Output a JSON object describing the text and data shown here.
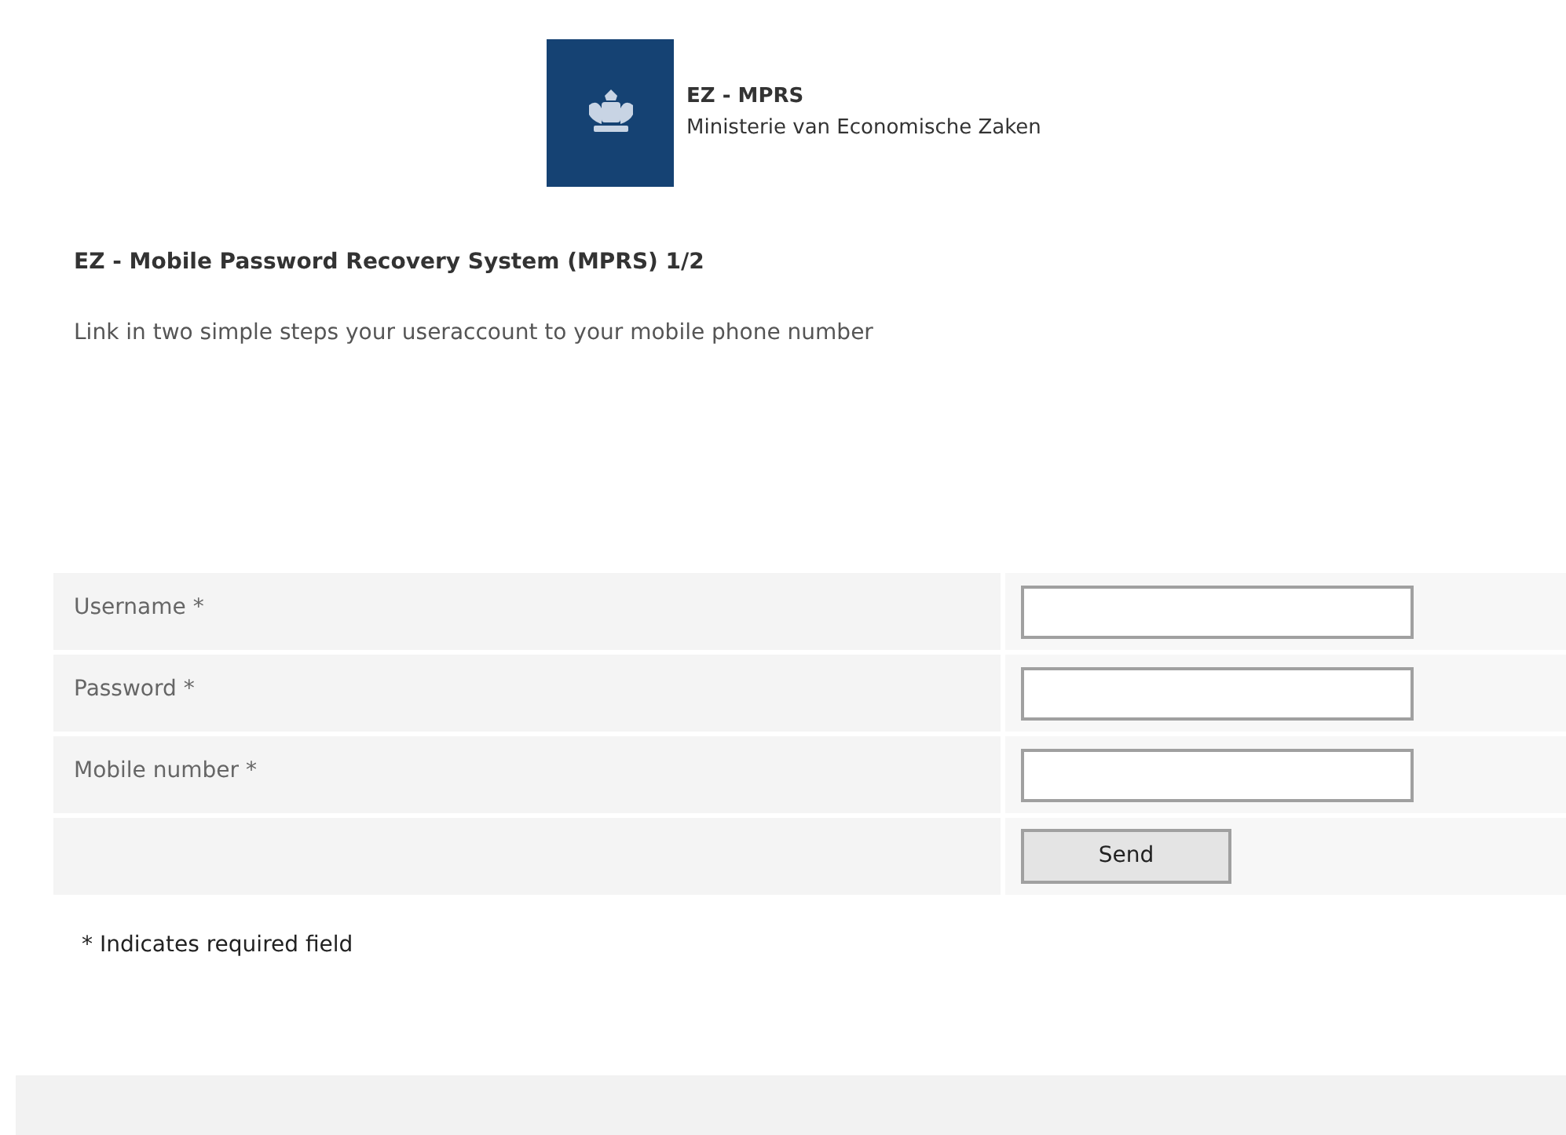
{
  "header": {
    "title": "EZ - MPRS",
    "subtitle": "Ministerie van Economische Zaken"
  },
  "heading": "EZ - Mobile Password Recovery System (MPRS) 1/2",
  "intro": "Link in two simple steps your useraccount to your mobile phone number",
  "form": {
    "fields": [
      {
        "label": "Username *"
      },
      {
        "label": "Password *"
      },
      {
        "label": "Mobile number *"
      }
    ],
    "submit": "Send"
  },
  "footnote": "* Indicates required field"
}
